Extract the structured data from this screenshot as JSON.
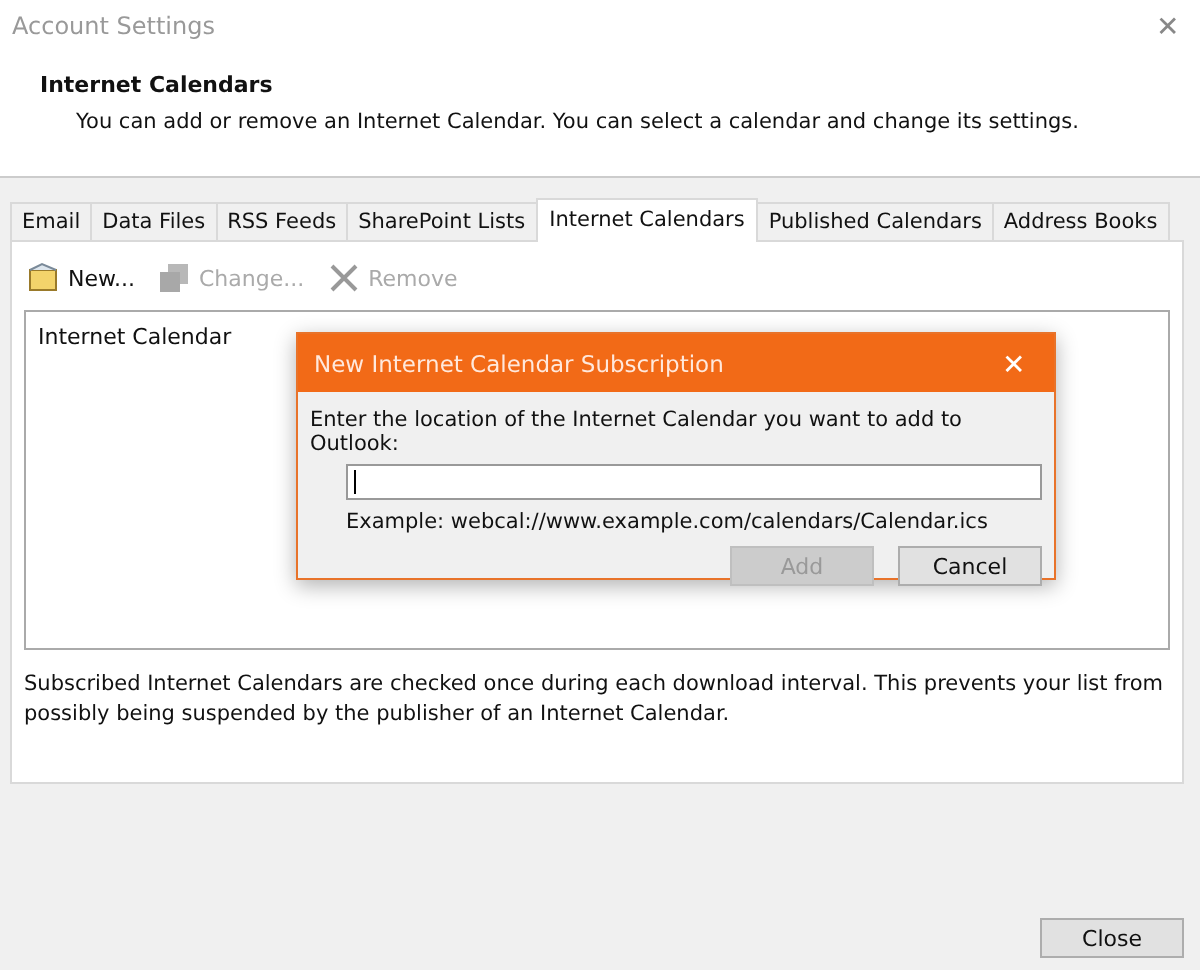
{
  "window": {
    "title": "Account Settings",
    "close": "✕"
  },
  "header": {
    "title": "Internet Calendars",
    "description": "You can add or remove an Internet Calendar. You can select a calendar and change its settings."
  },
  "tabs": [
    {
      "label": "Email",
      "selected": false
    },
    {
      "label": "Data Files",
      "selected": false
    },
    {
      "label": "RSS Feeds",
      "selected": false
    },
    {
      "label": "SharePoint Lists",
      "selected": false
    },
    {
      "label": "Internet Calendars",
      "selected": true
    },
    {
      "label": "Published Calendars",
      "selected": false
    },
    {
      "label": "Address Books",
      "selected": false
    }
  ],
  "toolbar": [
    {
      "label": "New...",
      "kind": "new",
      "disabled": false
    },
    {
      "label": "Change...",
      "kind": "change",
      "disabled": true
    },
    {
      "label": "Remove",
      "kind": "remove",
      "disabled": true
    }
  ],
  "list": {
    "rows": [
      "Internet Calendar"
    ]
  },
  "note": "Subscribed Internet Calendars are checked once during each download interval. This prevents your list from possibly being suspended by the publisher of an Internet Calendar.",
  "dialog": {
    "title": "New Internet Calendar Subscription",
    "close": "✕",
    "prompt": "Enter the location of the Internet Calendar you want to add to Outlook:",
    "example": "Example: webcal://www.example.com/calendars/Calendar.ics",
    "buttons": [
      {
        "label": "Add",
        "disabled": true
      },
      {
        "label": "Cancel",
        "disabled": false
      }
    ]
  },
  "footer": {
    "button": "Close"
  }
}
